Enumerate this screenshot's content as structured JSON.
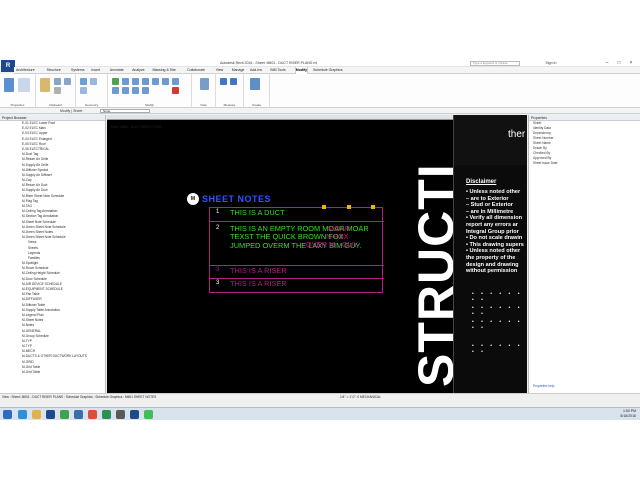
{
  "window": {
    "title": "Autodesk Revit 2016 - Sheet: M601 - DUCT RISER PLANS.rvt",
    "search_placeholder": "Type a keyword or phrase",
    "sign_in": "Sign In",
    "app_badge": "R"
  },
  "ribbon_tabs": [
    "Architecture",
    "Structure",
    "Systems",
    "Insert",
    "Annotate",
    "Analyze",
    "Massing & Site",
    "Collaborate",
    "View",
    "Manage",
    "Add-Ins",
    "BIM Tools",
    "Modify",
    "Schedule Graphics"
  ],
  "ribbon_groups": [
    "Properties",
    "Clipboard",
    "Geometry",
    "Modify",
    "View",
    "Measure",
    "Create"
  ],
  "propbar": {
    "label": "Modify | Sheet",
    "combo_value": "None"
  },
  "browser": {
    "title": "Project Browser",
    "items": [
      "E-01 ELEC Lower Roof",
      "E-02 ELEC Main",
      "E-03 ELEC Upper",
      "E-04 ELEC Enlarged",
      "E-05 ELEC Roof",
      "E-06 ELECTRICAL",
      "M-Duct Tag",
      "M-Return Air Grille",
      "M-Supply Air Grille",
      "M-Diffuser Symbol",
      "M-Supply Air Diffuser",
      "M-Cap",
      "M-Return Air Duct",
      "M-Supply Air Duct",
      "M-Riser Sheet Note Schedule",
      "M-Flag Tag",
      "M-TAG",
      "M-Ceiling Tag Annotation",
      "M-Section Tag Annotation",
      "M-Sheet Note Schedule",
      "M-Green Sheet Note Schedule",
      "M-Green Sheet Notes",
      "M-Green Sheet Note Schedule",
      "Views",
      "Sheets",
      "Legends",
      "Families",
      "M-Spotlight",
      "M-Room Schedule",
      "M-Ceiling Height Schedule",
      "M-Door Schedule",
      "M-AIR DEVICE SCHEDULE",
      "M-EQUIPMENT SCHEDULE",
      "M-Fan Table",
      "M-DIFFUSER",
      "M-Diffuser Table",
      "M-Supply Table Annotation",
      "M-Legend Plan",
      "M-Sheet Notes",
      "M-Notes",
      "M-GENERAL",
      "M-Group Schedule",
      "M-TYP",
      "M-TYP",
      "M-MECH",
      "M-DUCTS & OTHER DUCTWORK LAYOUTS",
      "M-GRID",
      "M-Grid Table",
      "M-Grid Table"
    ]
  },
  "canvas": {
    "tab_label": "Sheet: M601 - DUCT RISER PLANS",
    "notes_title": "SHEET NOTES",
    "title_badge": "M",
    "rows": [
      {
        "num": "1",
        "text": "THIS IS A DUCT"
      },
      {
        "num": "2",
        "text": "THIS IS AN EMPTY ROOM MOAR MOAR TEXST THE QUICK BROWN FOX JUMPED OVERM THE LAXY BIM GUY."
      },
      {
        "num": "3",
        "text": "THIS IS A RISER"
      },
      {
        "num": "3",
        "text": "THIS IS A RISER"
      }
    ],
    "overlay_fragments": [
      "MOAR",
      "N FOX",
      "OVER M",
      "GUY"
    ],
    "big_word": "STRUCTI",
    "side_top_text": "ther",
    "disclaimer_title": "Disclaimer",
    "disclaimer_lines": [
      "• Unless noted other",
      "– are to Exterior",
      "– Stud or Exterior",
      "– are in Millimetre",
      "• Verify all dimension",
      "  report any errors ar",
      "  Integral Group prior",
      "• Do not scale drawin",
      "• This drawing supers",
      "• Unless noted other",
      "  the property of the",
      "  design and drawing",
      "  without permission"
    ]
  },
  "props": {
    "title": "Properties",
    "rows": [
      "Sheet",
      "Identity Data",
      "Dependency",
      "Sheet Number",
      "Sheet Name",
      "Drawn By",
      "Checked By",
      "Approved By",
      "Sheet Issue Date"
    ],
    "apply_label": "Properties help"
  },
  "status": {
    "text": "View : Sheet: M601 - DUCT RISER PLANS : Schedule Graphics : Schedule Graphics : M601 SHEET NOTES",
    "view_text": "1/4\" = 1'-0\"   :0   MECHANICAL"
  },
  "taskbar": {
    "time": "1:50 PM",
    "date": "5/16/2016"
  },
  "colors": {
    "title_blue": "#2a55ff",
    "note_green": "#3ddc2a",
    "frame_magenta": "#b0207a",
    "grip_orange": "#ffb000"
  }
}
